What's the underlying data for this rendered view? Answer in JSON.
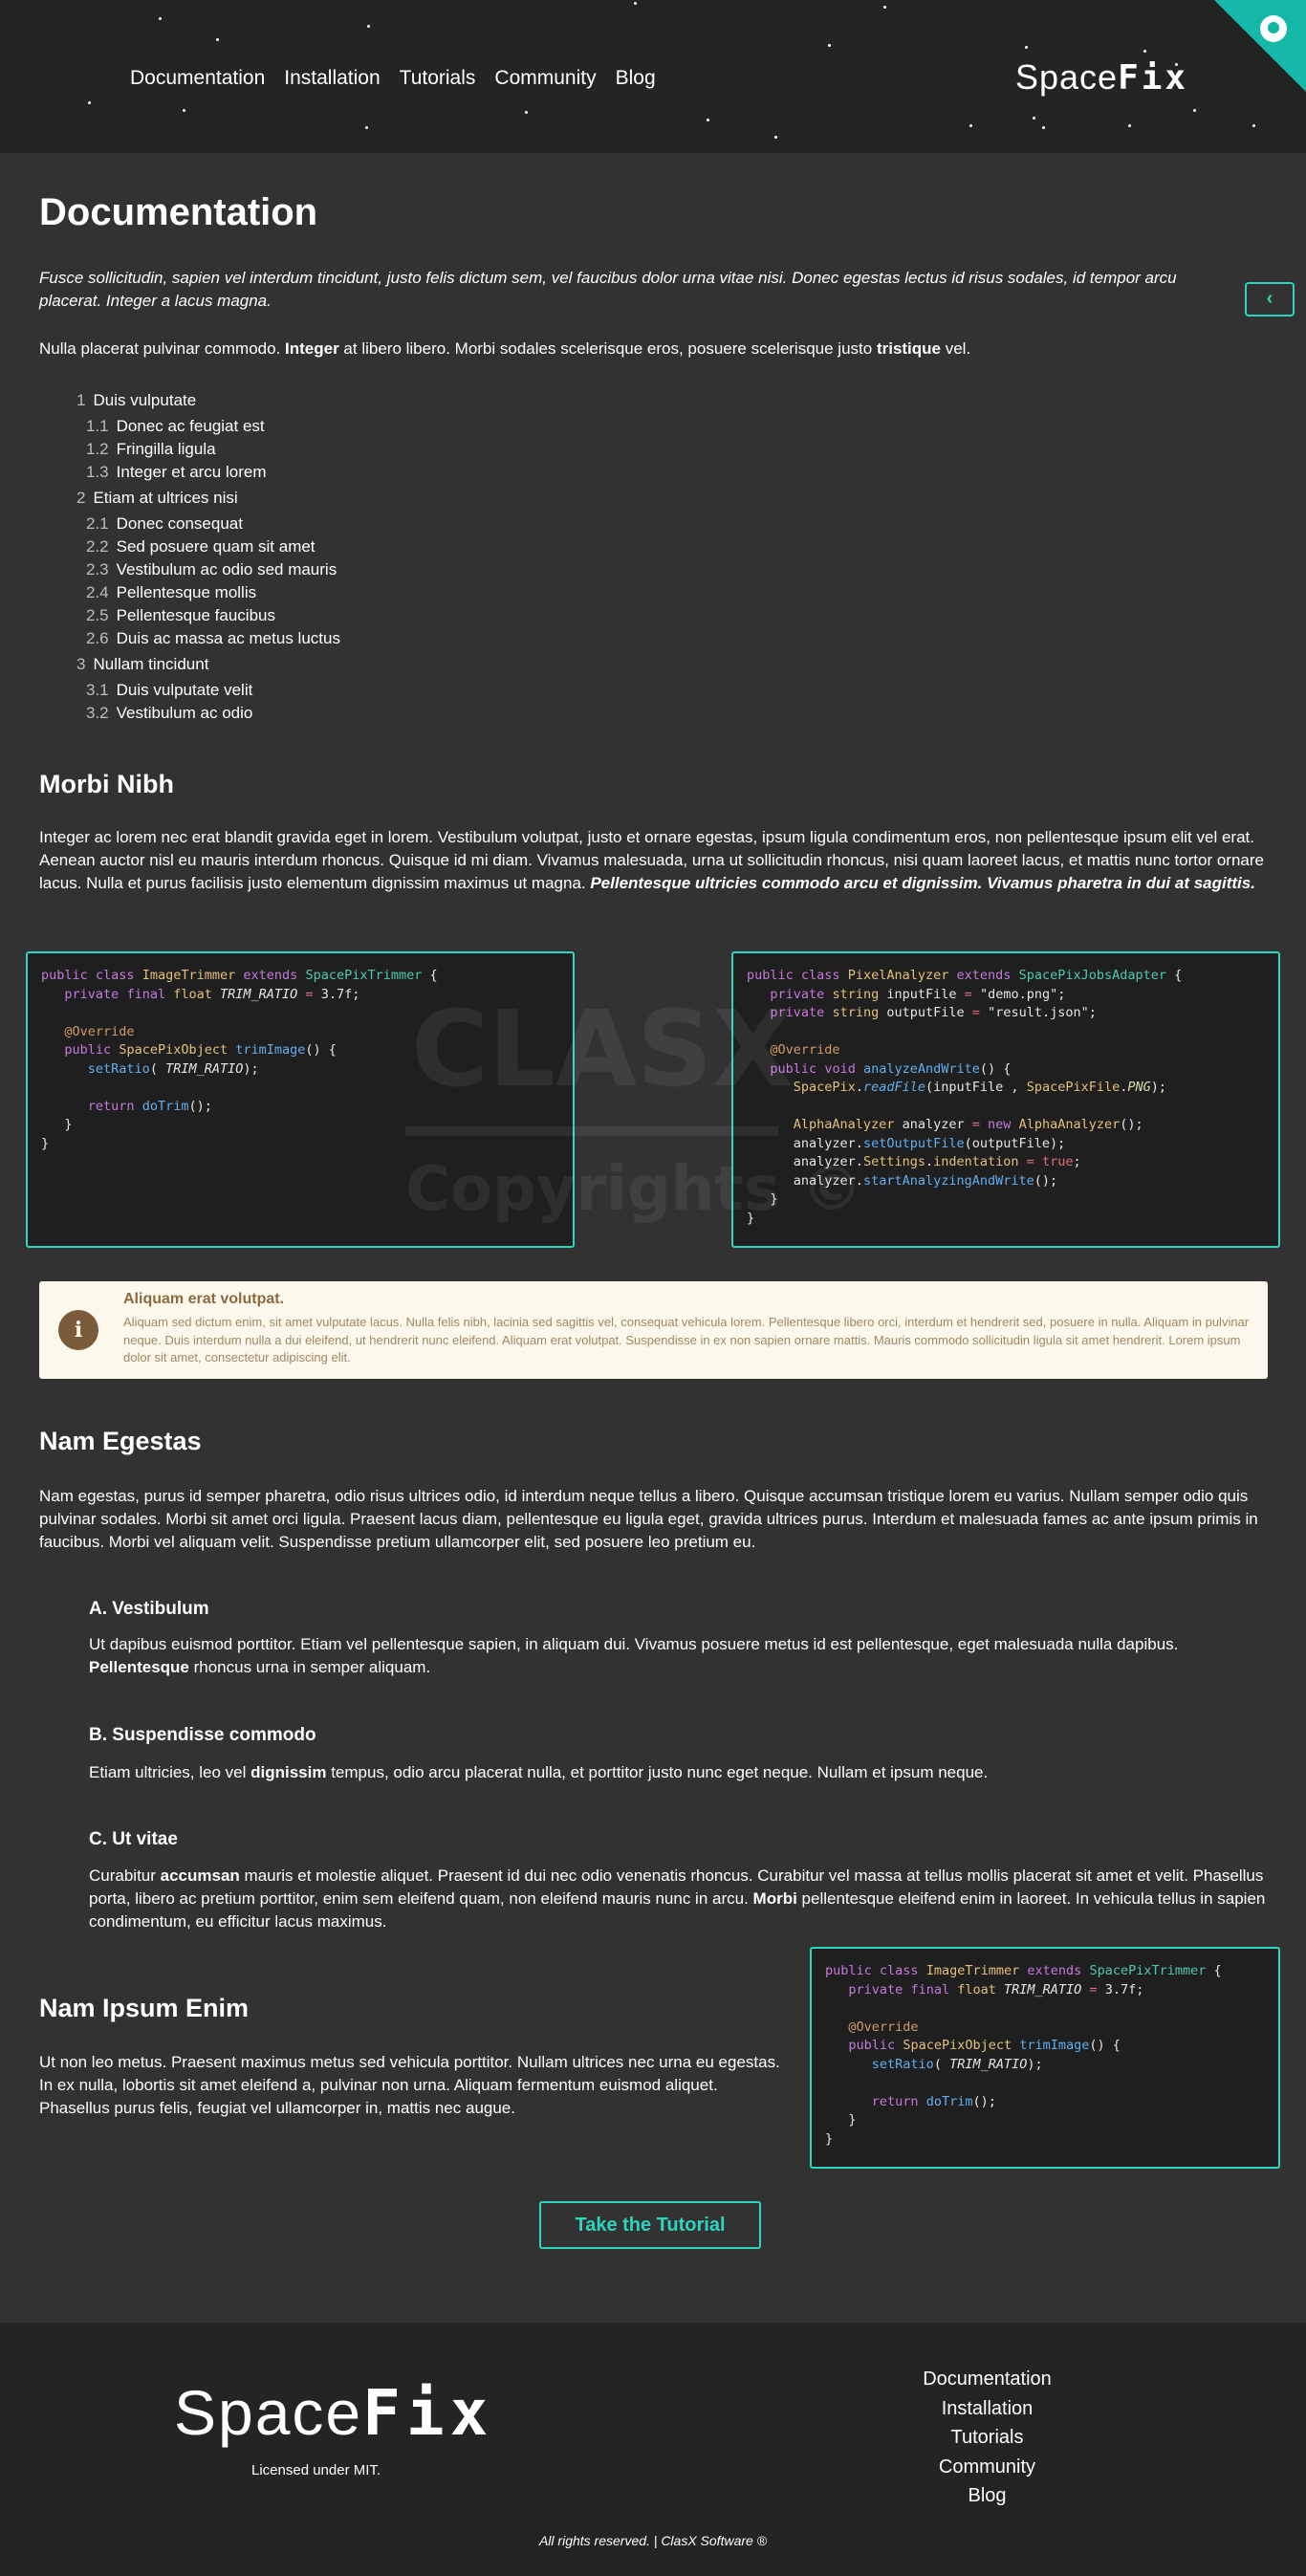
{
  "header": {
    "nav": [
      "Documentation",
      "Installation",
      "Tutorials",
      "Community",
      "Blog"
    ],
    "logo_light": "Space",
    "logo_bold": "Fix"
  },
  "page": {
    "title": "Documentation",
    "lead": "Fusce sollicitudin, sapien vel interdum tincidunt, justo felis dictum sem, vel faucibus dolor urna vitae nisi. Donec egestas lectus id risus sodales, id tempor arcu placerat. Integer a lacus magna.",
    "collapse_icon": "chevron-left-icon",
    "intro": {
      "before": "Nulla placerat pulvinar commodo. ",
      "bold1": "Integer",
      "middle": " at libero libero. Morbi sodales scelerisque eros, posuere scelerisque justo ",
      "bold2": "tristique",
      "after": " vel."
    }
  },
  "toc": [
    {
      "num": "1",
      "label": "Duis vulputate",
      "children": [
        {
          "num": "1.1",
          "label": "Donec ac feugiat est"
        },
        {
          "num": "1.2",
          "label": "Fringilla ligula"
        },
        {
          "num": "1.3",
          "label": "Integer et arcu lorem"
        }
      ]
    },
    {
      "num": "2",
      "label": "Etiam at ultrices nisi",
      "children": [
        {
          "num": "2.1",
          "label": "Donec consequat"
        },
        {
          "num": "2.2",
          "label": "Sed posuere quam sit amet"
        },
        {
          "num": "2.3",
          "label": "Vestibulum ac odio sed mauris"
        },
        {
          "num": "2.4",
          "label": "Pellentesque mollis"
        },
        {
          "num": "2.5",
          "label": "Pellentesque faucibus"
        },
        {
          "num": "2.6",
          "label": "Duis ac massa ac metus luctus"
        }
      ]
    },
    {
      "num": "3",
      "label": "Nullam tincidunt",
      "children": [
        {
          "num": "3.1",
          "label": "Duis vulputate velit"
        },
        {
          "num": "3.2",
          "label": "Vestibulum ac odio"
        }
      ]
    }
  ],
  "morbi": {
    "heading": "Morbi Nibh",
    "text": "Integer ac lorem nec erat blandit gravida eget in lorem. Vestibulum volutpat, justo et ornare egestas, ipsum ligula condimentum eros, non pellentesque ipsum elit vel erat. Aenean auctor nisl eu mauris interdum rhoncus. Quisque id mi diam. Vivamus malesuada, urna ut sollicitudin rhoncus, nisi quam laoreet lacus, et mattis nunc tortor ornare lacus. Nulla et purus facilisis justo elementum dignissim maximus ut magna. ",
    "emphasis": "Pellentesque ultricies commodo arcu et dignissim. Vivamus pharetra in dui at sagittis."
  },
  "code_left": {
    "line1": [
      "public",
      "class",
      "ImageTrimmer",
      "extends",
      "SpacePixTrimmer",
      "{"
    ],
    "line2": [
      "private",
      "final",
      "float",
      "TRIM_RATIO",
      "=",
      "3.7f;"
    ],
    "line4": "@Override",
    "line5": [
      "public",
      "SpacePixObject",
      "trimImage",
      "() {"
    ],
    "line6": [
      "setRatio",
      "(",
      "TRIM_RATIO",
      ");"
    ],
    "line8": [
      "return",
      "doTrim",
      "();"
    ],
    "line9": "}",
    "line10": "}"
  },
  "code_right": {
    "line1": [
      "public",
      "class",
      "PixelAnalyzer",
      "extends",
      "SpacePixJobsAdapter",
      "{"
    ],
    "line2": [
      "private",
      "string",
      "inputFile",
      "=",
      "\"demo.png\";"
    ],
    "line3": [
      "private",
      "string",
      "outputFile",
      "=",
      "\"result.json\";"
    ],
    "line5": "@Override",
    "line6": [
      "public",
      "void",
      "analyzeAndWrite",
      "() {"
    ],
    "line7": [
      "SpacePix",
      ".",
      "readFile",
      "(",
      "inputFile",
      ",",
      "SpacePixFile",
      ".",
      "PNG",
      ");"
    ],
    "line9": [
      "AlphaAnalyzer",
      "analyzer",
      "=",
      "new",
      "AlphaAnalyzer",
      "();"
    ],
    "line10": [
      "analyzer.",
      "setOutputFile",
      "(outputFile);"
    ],
    "line11": [
      "analyzer.",
      "Settings",
      ".",
      "indentation",
      "=",
      "true",
      ";"
    ],
    "line12": [
      "analyzer.",
      "startAnalyzingAndWrite",
      "();"
    ],
    "line13": "}",
    "line14": "}"
  },
  "watermark": {
    "logo": "CLASX",
    "text": "Copyrights ©"
  },
  "alert": {
    "icon": "info-icon",
    "icon_glyph": "i",
    "title": "Aliquam erat volutpat.",
    "body": "Aliquam sed dictum enim, sit amet vulputate lacus. Nulla felis nibh, lacinia sed sagittis vel, consequat vehicula lorem. Pellentesque libero orci, interdum et hendrerit sed, posuere in nulla. Aliquam in pulvinar neque. Duis interdum nulla a dui eleifend, ut hendrerit nunc eleifend. Aliquam erat volutpat. Suspendisse in ex non sapien ornare mattis. Mauris commodo sollicitudin ligula sit amet hendrerit. Lorem ipsum dolor sit amet, consectetur adipiscing elit."
  },
  "nam": {
    "heading": "Nam Egestas",
    "text": "Nam egestas, purus id semper pharetra, odio risus ultrices odio, id interdum neque tellus a libero. Quisque accumsan tristique lorem eu varius. Nullam semper odio quis pulvinar sodales. Morbi sit amet orci ligula. Praesent lacus diam, pellentesque eu ligula eget, gravida ultrices purus. Interdum et malesuada fames ac ante ipsum primis in faucibus. Morbi vel aliquam velit. Suspendisse pretium ullamcorper elit, sed posuere leo pretium eu."
  },
  "sub_a": {
    "heading": "A. Vestibulum",
    "text": "Ut dapibus euismod porttitor. Etiam vel pellentesque sapien, in aliquam dui. Vivamus posuere metus id est pellentesque, eget malesuada nulla dapibus. ",
    "bold": "Pellentesque",
    "after": " rhoncus urna in semper aliquam."
  },
  "sub_b": {
    "heading": "B. Suspendisse commodo",
    "before": "Etiam ultricies, leo vel ",
    "bold": "dignissim",
    "after": " tempus, odio arcu placerat nulla, et porttitor justo nunc eget neque. Nullam et ipsum neque."
  },
  "sub_c": {
    "heading": "C. Ut vitae",
    "before": "Curabitur ",
    "bold1": "accumsan",
    "middle": " mauris et molestie aliquet. Praesent id dui nec odio venenatis rhoncus. Curabitur vel massa at tellus mollis placerat sit amet et velit. Phasellus porta, libero ac pretium porttitor, enim sem eleifend quam, non eleifend mauris nunc in arcu. ",
    "bold2": "Morbi",
    "after": " pellentesque eleifend enim in laoreet. In vehicula tellus in sapien condimentum, eu efficitur lacus maximus."
  },
  "ipsum": {
    "heading": "Nam Ipsum Enim",
    "text": "Ut non leo metus. Praesent maximus metus sed vehicula porttitor. Nullam ultrices nec urna eu egestas. In ex nulla, lobortis sit amet eleifend a, pulvinar non urna. Aliquam fermentum euismod aliquet. Phasellus purus felis, feugiat vel ullamcorper in, mattis nec augue."
  },
  "tutorial_button": "Take the Tutorial",
  "footer": {
    "logo_light": "Space",
    "logo_bold": "Fix",
    "license": "Licensed under MIT.",
    "nav": [
      "Documentation",
      "Installation",
      "Tutorials",
      "Community",
      "Blog"
    ],
    "copyright": "All rights reserved. | ClasX Software ®"
  },
  "colors": {
    "accent": "#2dd4bf",
    "background": "#323232",
    "header": "#242424",
    "github_corner": "#14b8a6"
  }
}
